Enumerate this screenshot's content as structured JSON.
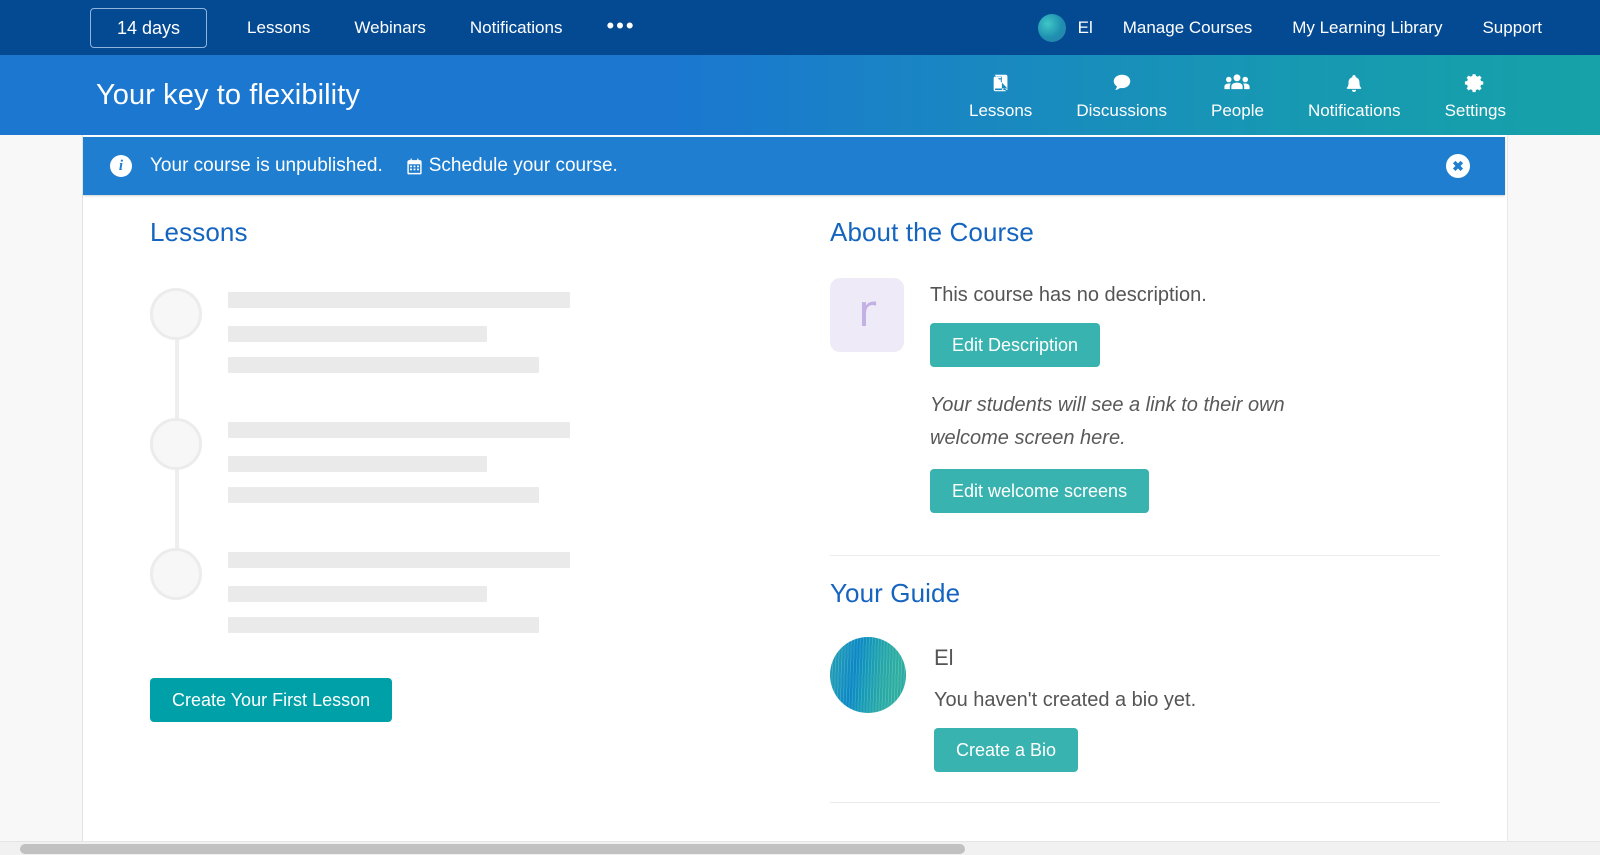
{
  "topbar": {
    "trial_label": "14 days",
    "nav": [
      {
        "label": "Lessons"
      },
      {
        "label": "Webinars"
      },
      {
        "label": "Notifications"
      },
      {
        "label": "•••"
      }
    ],
    "user_name": "El",
    "right_nav": [
      {
        "label": "Manage Courses"
      },
      {
        "label": "My Learning Library"
      },
      {
        "label": "Support"
      }
    ]
  },
  "coursebar": {
    "title": "Your key to flexibility",
    "nav": [
      {
        "label": "Lessons",
        "icon": "book-icon"
      },
      {
        "label": "Discussions",
        "icon": "comment-icon"
      },
      {
        "label": "People",
        "icon": "people-icon"
      },
      {
        "label": "Notifications",
        "icon": "bell-icon"
      },
      {
        "label": "Settings",
        "icon": "gear-icon"
      }
    ]
  },
  "alert": {
    "icon": "info-icon",
    "message": "Your course is unpublished.",
    "action_label": "Schedule your course.",
    "action_icon": "calendar-icon",
    "close_icon": "close-icon"
  },
  "lessons": {
    "title": "Lessons",
    "create_button": "Create Your First Lesson"
  },
  "about": {
    "title": "About the Course",
    "thumbnail_letter": "r",
    "description": "This course has no description.",
    "edit_description_button": "Edit Description",
    "welcome_note": "Your students will see a link to their own welcome screen here.",
    "edit_welcome_button": "Edit welcome screens"
  },
  "guide": {
    "title": "Your Guide",
    "name": "El",
    "bio": "You haven't created a bio yet.",
    "create_bio_button": "Create a Bio"
  },
  "colors": {
    "topbar_blue": "#044a93",
    "course_blue": "#1b77d0",
    "course_teal": "#16a2a8",
    "alert_blue": "#1f7ed0",
    "heading_blue": "#1565c0",
    "primary_teal": "#00a0a8",
    "secondary_teal": "#39b3af",
    "thumb_lavender": "#efeaf8"
  }
}
